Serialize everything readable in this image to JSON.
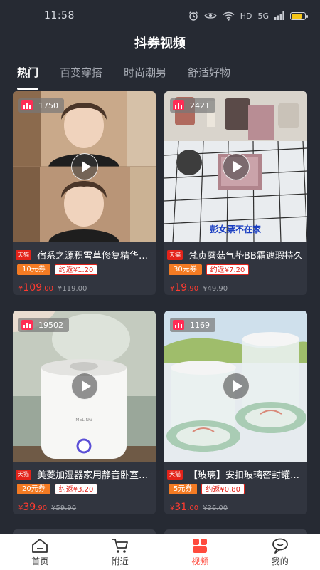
{
  "status": {
    "time": "11:58",
    "icons": [
      "alarm-icon",
      "eye-icon",
      "wifi-icon",
      "hd-icon",
      "signal-icon",
      "battery-icon"
    ],
    "hd_label": "HD",
    "signal_label": "5G",
    "battery_level_percent": 80
  },
  "app": {
    "title": "抖券视频"
  },
  "tabs": [
    {
      "label": "热门",
      "active": true
    },
    {
      "label": "百变穿搭",
      "active": false
    },
    {
      "label": "时尚潮男",
      "active": false
    },
    {
      "label": "舒适好物",
      "active": false
    }
  ],
  "cards": [
    {
      "views": "1750",
      "badge": "天猫",
      "title": "宿系之源积雪草修复精华抗糖化妆水",
      "coupon": "10元券",
      "rebate": "约返¥1.20",
      "price_symbol": "¥",
      "price_int": "109",
      "price_dec": ".00",
      "orig_price": "¥119.00"
    },
    {
      "views": "2421",
      "badge": "天猫",
      "title": "梵贞蘑菇气垫BB霜遮瑕持久",
      "coupon": "30元券",
      "rebate": "约返¥7.20",
      "price_symbol": "¥",
      "price_int": "19",
      "price_dec": ".90",
      "orig_price": "¥49.90",
      "overlay_text": "彭女票不在家"
    },
    {
      "views": "19502",
      "badge": "天猫",
      "title": "美菱加湿器家用静音卧室大容量",
      "coupon": "20元券",
      "rebate": "约返¥3.20",
      "price_symbol": "¥",
      "price_int": "39",
      "price_dec": ".90",
      "orig_price": "¥59.90",
      "product_brand": "MELING"
    },
    {
      "views": "1169",
      "badge": "天猫",
      "title": "【玻璃】安扣玻璃密封罐储物罐",
      "coupon": "5元券",
      "rebate": "约返¥0.80",
      "price_symbol": "¥",
      "price_int": "31",
      "price_dec": ".00",
      "orig_price": "¥36.00"
    }
  ],
  "nav": [
    {
      "label": "首页",
      "icon": "home-icon",
      "active": false
    },
    {
      "label": "附近",
      "icon": "cart-icon",
      "active": false
    },
    {
      "label": "视频",
      "icon": "video-icon",
      "active": true
    },
    {
      "label": "我的",
      "icon": "chat-icon",
      "active": false
    }
  ],
  "colors": {
    "background": "#262a33",
    "card": "#31353f",
    "accent_red": "#ff3b30",
    "coupon_orange": "#f47b23",
    "nav_active": "#ff4b3e"
  }
}
